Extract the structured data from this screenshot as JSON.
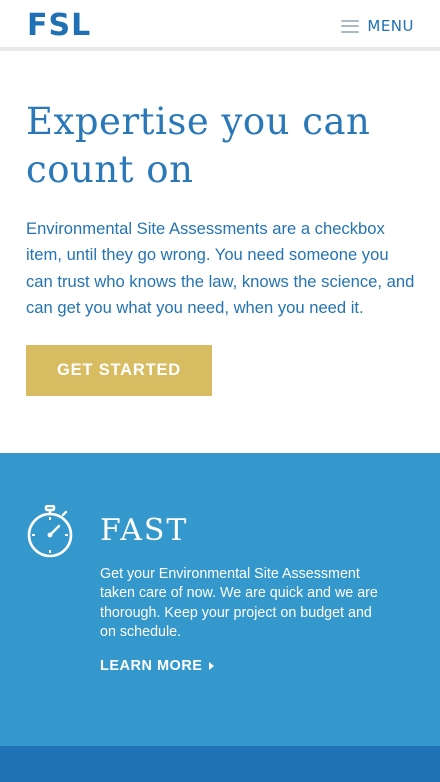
{
  "header": {
    "logo": "FSL",
    "menu_label": "MENU"
  },
  "hero": {
    "title": "Expertise you can count on",
    "text": "Environmental Site Assessments are a checkbox item, until they go wrong. You need someone you can trust who knows the law, knows the science, and can get you what you need, when you need it.",
    "cta_label": "GET STARTED"
  },
  "feature": {
    "icon": "stopwatch-icon",
    "title": "FAST",
    "text": "Get your Environmental Site Assessment taken care of now. We are quick and we are thorough. Keep your project on budget and on schedule.",
    "link_label": "LEARN MORE"
  },
  "colors": {
    "brand_blue": "#1f70b5",
    "feature_bg": "#3598cc",
    "cta_gold": "#d8bc62",
    "bottom_band": "#1e72b6"
  }
}
